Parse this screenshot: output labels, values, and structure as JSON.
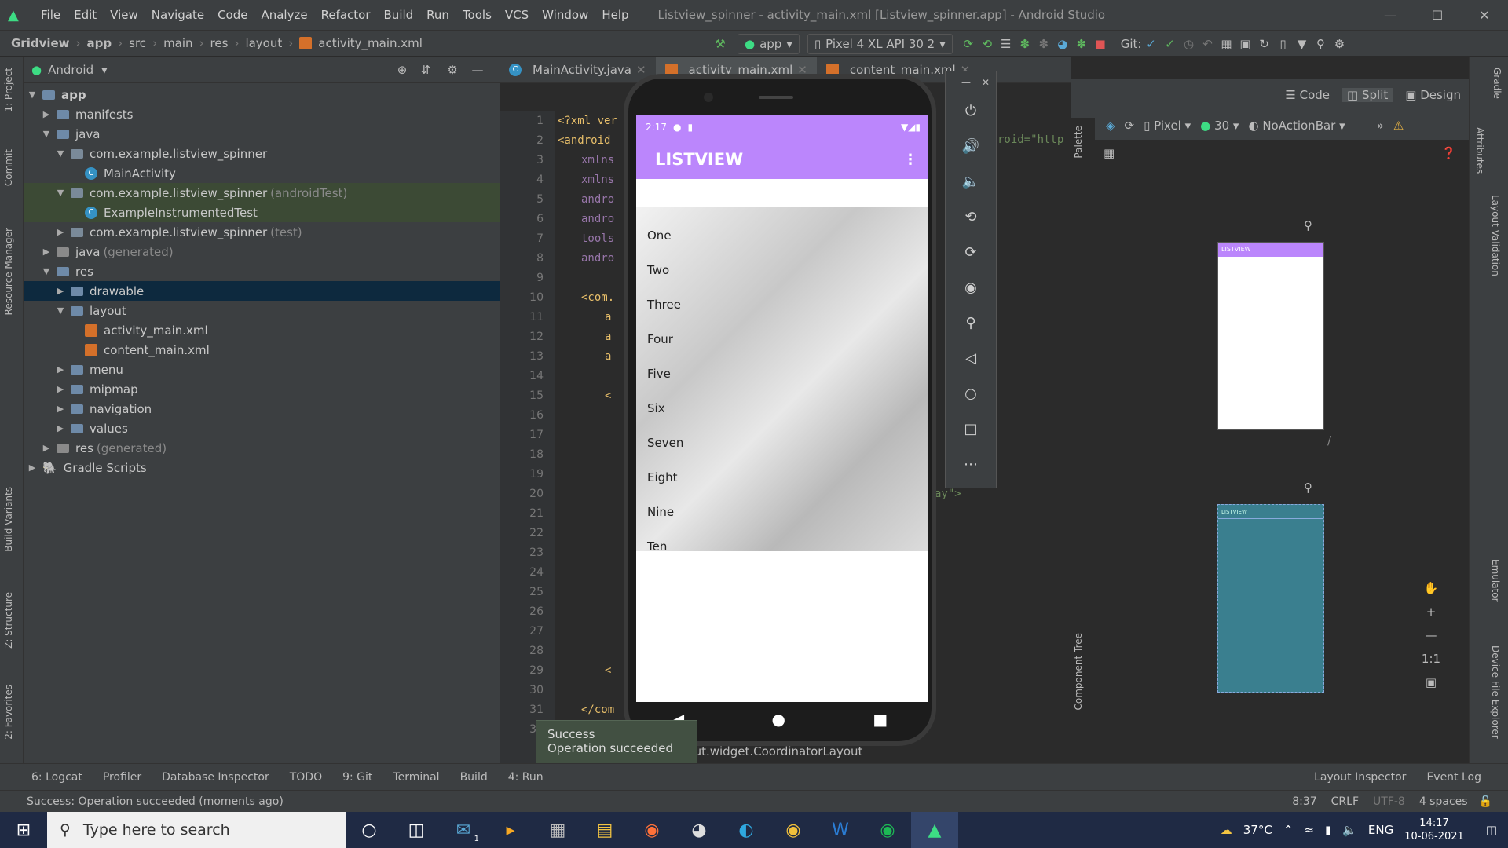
{
  "titlebar": {
    "menu": [
      "File",
      "Edit",
      "View",
      "Navigate",
      "Code",
      "Analyze",
      "Refactor",
      "Build",
      "Run",
      "Tools",
      "VCS",
      "Window",
      "Help"
    ],
    "title": "Listview_spinner - activity_main.xml [Listview_spinner.app] - Android Studio"
  },
  "navbar": {
    "crumbs": [
      "Gridview",
      "app",
      "src",
      "main",
      "res",
      "layout",
      "activity_main.xml"
    ],
    "run_config": "app",
    "device": "Pixel 4 XL API 30 2",
    "git_label": "Git:"
  },
  "left_strip": [
    "1: Project",
    "Commit",
    "Resource Manager",
    "Build Variants",
    "Z: Structure",
    "2: Favorites"
  ],
  "project": {
    "view_label": "Android",
    "tree": [
      {
        "label": "app",
        "level": 0,
        "icon": "folder",
        "open": true,
        "bold": true
      },
      {
        "label": "manifests",
        "level": 1,
        "icon": "folder"
      },
      {
        "label": "java",
        "level": 1,
        "icon": "folder",
        "open": true
      },
      {
        "label": "com.example.listview_spinner",
        "level": 2,
        "icon": "package",
        "open": true
      },
      {
        "label": "MainActivity",
        "level": 3,
        "icon": "class"
      },
      {
        "label": "com.example.listview_spinner",
        "suffix": "(androidTest)",
        "level": 2,
        "icon": "package",
        "open": true,
        "hl": true
      },
      {
        "label": "ExampleInstrumentedTest",
        "level": 3,
        "icon": "class",
        "hl": true
      },
      {
        "label": "com.example.listview_spinner",
        "suffix": "(test)",
        "level": 2,
        "icon": "package"
      },
      {
        "label": "java",
        "suffix": "(generated)",
        "level": 1,
        "icon": "folder-grey"
      },
      {
        "label": "res",
        "level": 1,
        "icon": "folder",
        "open": true
      },
      {
        "label": "drawable",
        "level": 2,
        "icon": "folder",
        "selected": true
      },
      {
        "label": "layout",
        "level": 2,
        "icon": "folder",
        "open": true
      },
      {
        "label": "activity_main.xml",
        "level": 3,
        "icon": "xml"
      },
      {
        "label": "content_main.xml",
        "level": 3,
        "icon": "xml"
      },
      {
        "label": "menu",
        "level": 2,
        "icon": "folder"
      },
      {
        "label": "mipmap",
        "level": 2,
        "icon": "folder"
      },
      {
        "label": "navigation",
        "level": 2,
        "icon": "folder"
      },
      {
        "label": "values",
        "level": 2,
        "icon": "folder"
      },
      {
        "label": "res",
        "suffix": "(generated)",
        "level": 1,
        "icon": "folder-grey"
      },
      {
        "label": "Gradle Scripts",
        "level": 0,
        "icon": "gradle"
      }
    ]
  },
  "editor": {
    "tabs": [
      "MainActivity.java",
      "activity_main.xml",
      "content_main.xml"
    ],
    "line_numbers": [
      "1",
      "2",
      "3",
      "4",
      "5",
      "6",
      "7",
      "8",
      "9",
      "10",
      "11",
      "12",
      "13",
      "14",
      "15",
      "16",
      "17",
      "18",
      "19",
      "20",
      "21",
      "22",
      "23",
      "24",
      "25",
      "26",
      "27",
      "28",
      "29",
      "30",
      "31",
      "32"
    ],
    "code": [
      "<?xml ver",
      "<android",
      "xmlns",
      "xmlns",
      "andro",
      "andro",
      "tools",
      "andro",
      "",
      "<com.",
      "a",
      "a",
      "a",
      "",
      "<",
      "",
      "",
      "",
      "",
      "",
      "",
      "",
      "",
      "",
      "",
      "",
      "",
      "",
      "<",
      "",
      "</com",
      ""
    ],
    "right_fragments": [
      "roid=\"http",
      "ay\">"
    ],
    "bottom_crumb": "rlayout.widget.CoordinatorLayout"
  },
  "design": {
    "modes": [
      "Code",
      "Split",
      "Design"
    ],
    "device": "Pixel",
    "api": "30",
    "theme": "NoActionBar",
    "palette_label": "Palette",
    "component_tree_label": "Component Tree",
    "preview_title": "LISTVIEW",
    "preview_title_blueprint": "LISTVIEW",
    "zoom_fit": "1:1"
  },
  "right_strip": [
    "Gradle",
    "Attributes",
    "Layout Validation",
    "Emulator",
    "Device File Explorer"
  ],
  "phone": {
    "time": "2:17",
    "app_title": "LISTVIEW",
    "items": [
      "One",
      "Two",
      "Three",
      "Four",
      "Five",
      "Six",
      "Seven",
      "Eight",
      "Nine",
      "Ten"
    ]
  },
  "emulator_controls": [
    "power-icon",
    "volume-up-icon",
    "volume-down-icon",
    "rotate-left-icon",
    "rotate-right-icon",
    "camera-icon",
    "zoom-icon",
    "back-icon",
    "home-icon",
    "overview-icon",
    "more-icon"
  ],
  "toast": {
    "line1": "Success",
    "line2": "Operation succeeded"
  },
  "bottom_tabs": [
    "6: Logcat",
    "Profiler",
    "Database Inspector",
    "TODO",
    "9: Git",
    "Terminal",
    "Build",
    "4: Run"
  ],
  "bottom_right_tabs": [
    "Layout Inspector",
    "Event Log"
  ],
  "status": {
    "message": "Success: Operation succeeded (moments ago)",
    "position": "8:37",
    "line_sep": "CRLF",
    "encoding": "UTF-8",
    "indent": "4 spaces"
  },
  "taskbar": {
    "search_placeholder": "Type here to search",
    "weather": "37°C",
    "lang": "ENG",
    "time": "14:17",
    "date": "10-06-2021",
    "mail_badge": "1"
  }
}
